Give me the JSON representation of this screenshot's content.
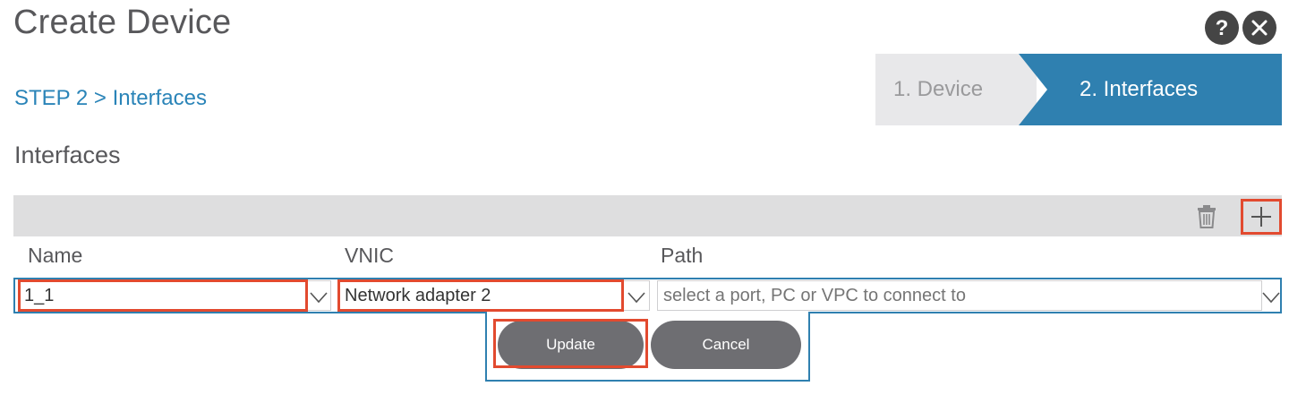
{
  "header": {
    "title": "Create Device",
    "help_icon": "help-icon",
    "close_icon": "close-icon"
  },
  "step": {
    "label": "STEP 2 > Interfaces"
  },
  "wizard": {
    "steps": [
      {
        "label": "1. Device",
        "active": false
      },
      {
        "label": "2. Interfaces",
        "active": true
      }
    ]
  },
  "interfaces": {
    "title": "Interfaces",
    "toolbar": {
      "delete_icon": "trash-icon",
      "add_icon": "plus-icon"
    },
    "columns": [
      "Name",
      "VNIC",
      "Path"
    ],
    "row": {
      "name": "1_1",
      "vnic": "Network adapter 2",
      "path_value": "",
      "path_placeholder": "select a port, PC or VPC to connect to"
    },
    "actions": {
      "update": "Update",
      "cancel": "Cancel"
    }
  },
  "colors": {
    "accent": "#2f80b0",
    "highlight": "#e24a2f",
    "button": "#6e6e72",
    "toolbar_bg": "#dededf"
  }
}
